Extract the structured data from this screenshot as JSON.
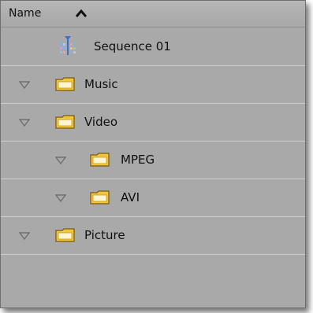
{
  "header": {
    "column_label": "Name",
    "sort_icon": "sort-ascending-icon"
  },
  "items": [
    {
      "label": "Sequence 01",
      "icon": "sequence-icon",
      "expandable": false,
      "depth": 1
    },
    {
      "label": "Music",
      "icon": "folder-icon",
      "expandable": true,
      "depth": 0
    },
    {
      "label": "Video",
      "icon": "folder-icon",
      "expandable": true,
      "depth": 0
    },
    {
      "label": "MPEG",
      "icon": "folder-icon",
      "expandable": true,
      "depth": 1
    },
    {
      "label": "AVI",
      "icon": "folder-icon",
      "expandable": true,
      "depth": 1
    },
    {
      "label": "Picture",
      "icon": "folder-icon",
      "expandable": true,
      "depth": 0
    }
  ],
  "colors": {
    "panel_background": "#a9a9a9",
    "row_separator": "#cfcfcf",
    "folder_fill": "#f3c53b",
    "folder_outline": "#7a5a10"
  }
}
